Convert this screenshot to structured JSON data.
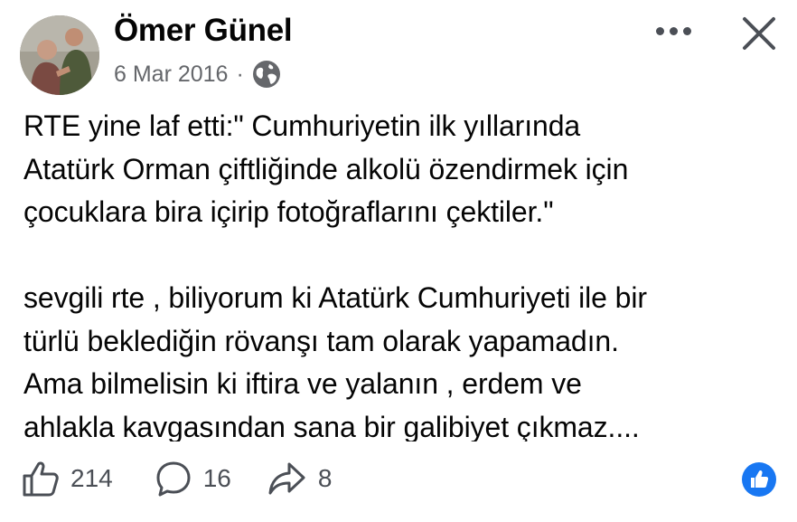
{
  "post": {
    "author": "Ömer Günel",
    "date": "6 Mar 2016",
    "separator": "·",
    "privacy_icon": "globe-icon",
    "text": "RTE yine laf etti:\" Cumhuriyetin ilk yıllarında\nAtatürk Orman çiftliğinde alkolü özendirmek için\nçocuklara bira içirip fotoğraflarını çektiler.\"\n\nsevgili rte , biliyorum ki Atatürk Cumhuriyeti ile bir\ntürlü beklediğin rövanşı tam olarak yapamadın.\nAma bilmelisin ki iftira ve yalanın , erdem ve\nahlakla kavgasından sana bir galibiyet çıkmaz...."
  },
  "actions": {
    "likes": "214",
    "comments": "16",
    "shares": "8"
  },
  "colors": {
    "accent": "#1877f2",
    "icon_gray": "#4b4f56",
    "meta_gray": "#65676b"
  }
}
